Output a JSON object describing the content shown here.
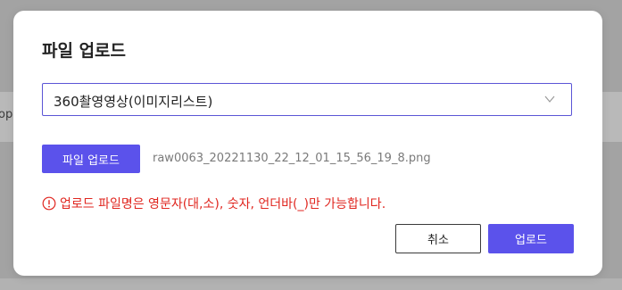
{
  "background": {
    "partial_text": "op"
  },
  "modal": {
    "title": "파일 업로드",
    "select": {
      "value": "360촬영영상(이미지리스트)",
      "icon": "chevron-down-icon"
    },
    "upload_button_label": "파일 업로드",
    "file_name": "raw0063_20221130_22_12_01_15_56_19_8.png",
    "error": {
      "icon": "error-circle-icon",
      "text": "업로드 파일명은 영문자(대,소), 숫자, 언더바(_)만 가능합니다."
    },
    "buttons": {
      "cancel_label": "취소",
      "submit_label": "업로드"
    }
  },
  "colors": {
    "accent": "#5b52eb",
    "error": "#e0261f",
    "select_border": "#5b55d6"
  }
}
